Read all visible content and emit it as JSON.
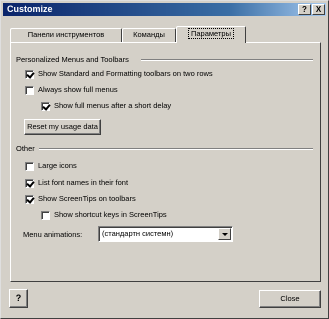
{
  "window": {
    "title": "Customize",
    "help_glyph": "?",
    "close_glyph": "X"
  },
  "tabs": [
    {
      "label": "Панели инструментов"
    },
    {
      "label": "Команды"
    },
    {
      "label": "Параметры",
      "selected": true
    }
  ],
  "personalized": {
    "heading": "Personalized Menus and Toolbars",
    "options": [
      {
        "label": "Show Standard and Formatting toolbars on two rows",
        "checked": true
      },
      {
        "label": "Always show full menus",
        "checked": false
      },
      {
        "label": "Show full menus after a short delay",
        "checked": true
      }
    ],
    "reset_label": "Reset my usage data"
  },
  "other": {
    "heading": "Other",
    "options": [
      {
        "label": "Large icons",
        "checked": false
      },
      {
        "label": "List font names in their font",
        "checked": true
      },
      {
        "label": "Show ScreenTips on toolbars",
        "checked": true
      },
      {
        "label": "Show shortcut keys in ScreenTips",
        "checked": false
      }
    ],
    "menu_animations": {
      "label": "Menu animations:",
      "value": "(стандартн системн)"
    }
  },
  "footer": {
    "help_icon_glyph": "?",
    "close_label": "Close"
  },
  "colors": {
    "face": "#d4d0c8",
    "title_start": "#0a246a",
    "title_end": "#a6caf0"
  }
}
